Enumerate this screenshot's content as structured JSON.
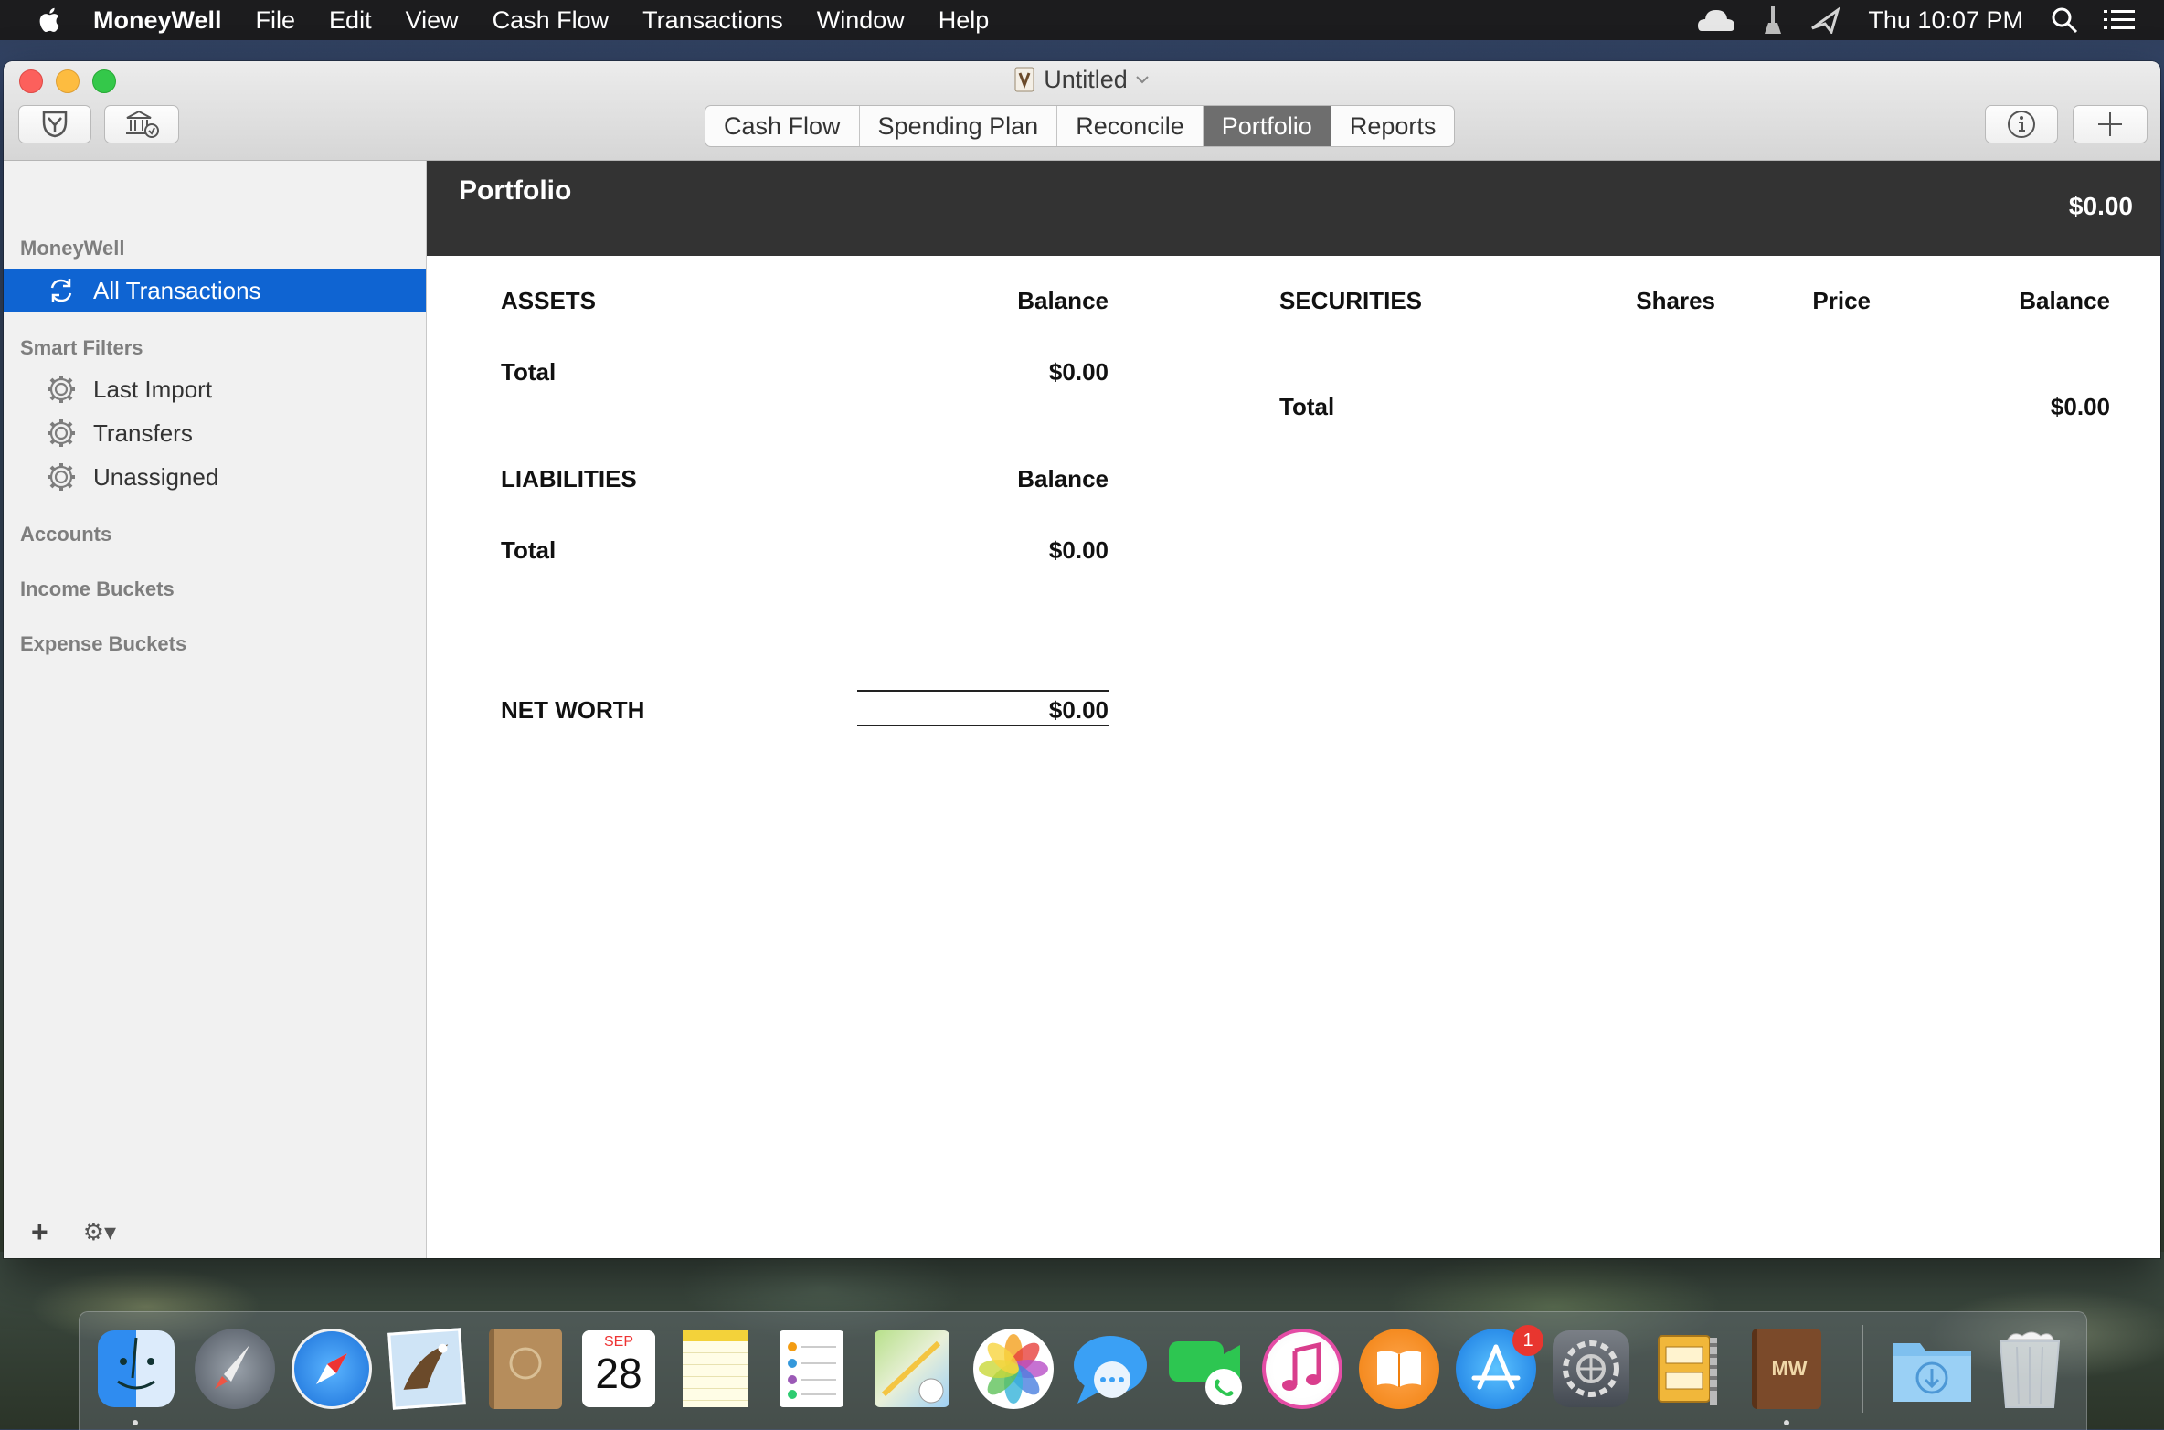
{
  "menubar": {
    "app_name": "MoneyWell",
    "items": [
      "File",
      "Edit",
      "View",
      "Cash Flow",
      "Transactions",
      "Window",
      "Help"
    ],
    "clock": "Thu 10:07 PM",
    "status_icons": [
      "cloud-icon",
      "broom-icon",
      "airplay-icon",
      "search-icon",
      "list-icon"
    ]
  },
  "window": {
    "title": "Untitled",
    "toolbar_left": [
      "envelope-icon",
      "bank-sync-icon"
    ],
    "tabs": [
      {
        "label": "Cash Flow",
        "active": false
      },
      {
        "label": "Spending Plan",
        "active": false
      },
      {
        "label": "Reconcile",
        "active": false
      },
      {
        "label": "Portfolio",
        "active": true
      },
      {
        "label": "Reports",
        "active": false
      }
    ],
    "toolbar_right": [
      "info-icon",
      "plus-icon"
    ]
  },
  "sidebar": {
    "section_moneywell": "MoneyWell",
    "all_transactions": "All Transactions",
    "section_smart": "Smart Filters",
    "smart_filters": [
      "Last Import",
      "Transfers",
      "Unassigned"
    ],
    "section_accounts": "Accounts",
    "section_income": "Income Buckets",
    "section_expense": "Expense Buckets",
    "footer_add": "+",
    "footer_gear": "⚙▾"
  },
  "portfolio": {
    "title": "Portfolio",
    "header_total": "$0.00",
    "assets": {
      "heading": "ASSETS",
      "col": "Balance",
      "total_label": "Total",
      "total_value": "$0.00"
    },
    "liabilities": {
      "heading": "LIABILITIES",
      "col": "Balance",
      "total_label": "Total",
      "total_value": "$0.00"
    },
    "net_worth": {
      "label": "NET WORTH",
      "value": "$0.00"
    },
    "securities": {
      "heading": "SECURITIES",
      "col_shares": "Shares",
      "col_price": "Price",
      "col_balance": "Balance",
      "total_label": "Total",
      "total_value": "$0.00"
    }
  },
  "dock": {
    "apps": [
      "Finder",
      "Launchpad",
      "Safari",
      "Mail",
      "Contacts",
      "Calendar",
      "Notes",
      "Reminders",
      "Maps",
      "Photos",
      "Messages",
      "FaceTime",
      "iTunes",
      "iBooks",
      "App Store",
      "System Preferences",
      "Archive Utility",
      "MoneyWell",
      "Downloads",
      "Trash"
    ],
    "calendar_month": "SEP",
    "calendar_day": "28",
    "appstore_badge": "1",
    "moneywell_label": "MW"
  },
  "colors": {
    "selection": "#0f64d2",
    "header_bg": "#333333",
    "active_tab": "#6e6e6e"
  }
}
